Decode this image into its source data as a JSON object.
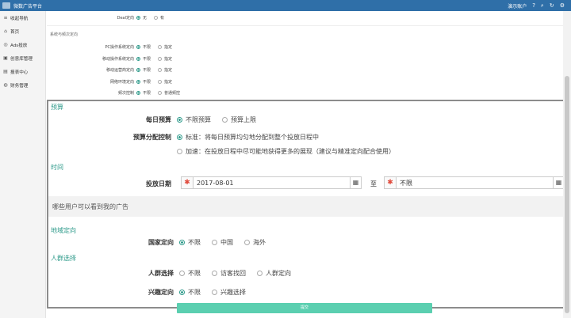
{
  "topbar": {
    "title": "微数广告平台",
    "user": "演示账户"
  },
  "sidebar": {
    "items": [
      {
        "icon": "menu-icon",
        "glyph": "≡",
        "label": "收起导航"
      },
      {
        "icon": "home-icon",
        "glyph": "⌂",
        "label": "首页"
      },
      {
        "icon": "ads-icon",
        "glyph": "◎",
        "label": "Ads投放"
      },
      {
        "icon": "creative-icon",
        "glyph": "▣",
        "label": "创意库管理"
      },
      {
        "icon": "report-icon",
        "glyph": "▤",
        "label": "报表中心"
      },
      {
        "icon": "finance-icon",
        "glyph": "◍",
        "label": "财务管理"
      }
    ]
  },
  "background_form": {
    "deal": {
      "label": "Deal定向",
      "opt1": "无",
      "opt2": "有"
    },
    "section_label": "系统与频次定向",
    "rows": [
      {
        "label": "PC操作系统定向",
        "opt1": "不限",
        "opt2": "指定"
      },
      {
        "label": "移动操作系统定向",
        "opt1": "不限",
        "opt2": "指定"
      },
      {
        "label": "移动运营商定向",
        "opt1": "不限",
        "opt2": "指定"
      },
      {
        "label": "网络环境定向",
        "opt1": "不限",
        "opt2": "指定"
      },
      {
        "label": "频次控制",
        "opt1": "不限",
        "opt2": "普通频控"
      }
    ]
  },
  "budget": {
    "section_title": "预算",
    "daily_label": "每日预算",
    "daily_opt1": "不限预算",
    "daily_opt2": "预算上限",
    "alloc_label": "预算分配控制",
    "alloc_opt1": "标准：将每日预算均匀地分配到整个投放日程中",
    "alloc_opt2": "加速：在投放日程中尽可能地获得更多的展现（建议与精准定向配合使用）"
  },
  "time": {
    "section_title": "时间",
    "date_label": "投放日期",
    "start_date": "2017-08-01",
    "to_label": "至",
    "end_date": "不限",
    "required_mark": "✱"
  },
  "audience_band": "哪些用户可以看到我的广告",
  "region": {
    "section_title": "地域定向",
    "country_label": "国家定向",
    "opt1": "不限",
    "opt2": "中国",
    "opt3": "海外"
  },
  "crowd": {
    "section_title": "人群选择",
    "crowd_label": "人群选择",
    "crowd_opt1": "不限",
    "crowd_opt2": "访客找回",
    "crowd_opt3": "人群定向",
    "interest_label": "兴趣定向",
    "interest_opt1": "不限",
    "interest_opt2": "兴趣选择"
  },
  "submit_label": "提交",
  "colors": {
    "accent": "#2d9a8a",
    "topbar": "#2f6fa8",
    "submit": "#5bcfb0"
  }
}
